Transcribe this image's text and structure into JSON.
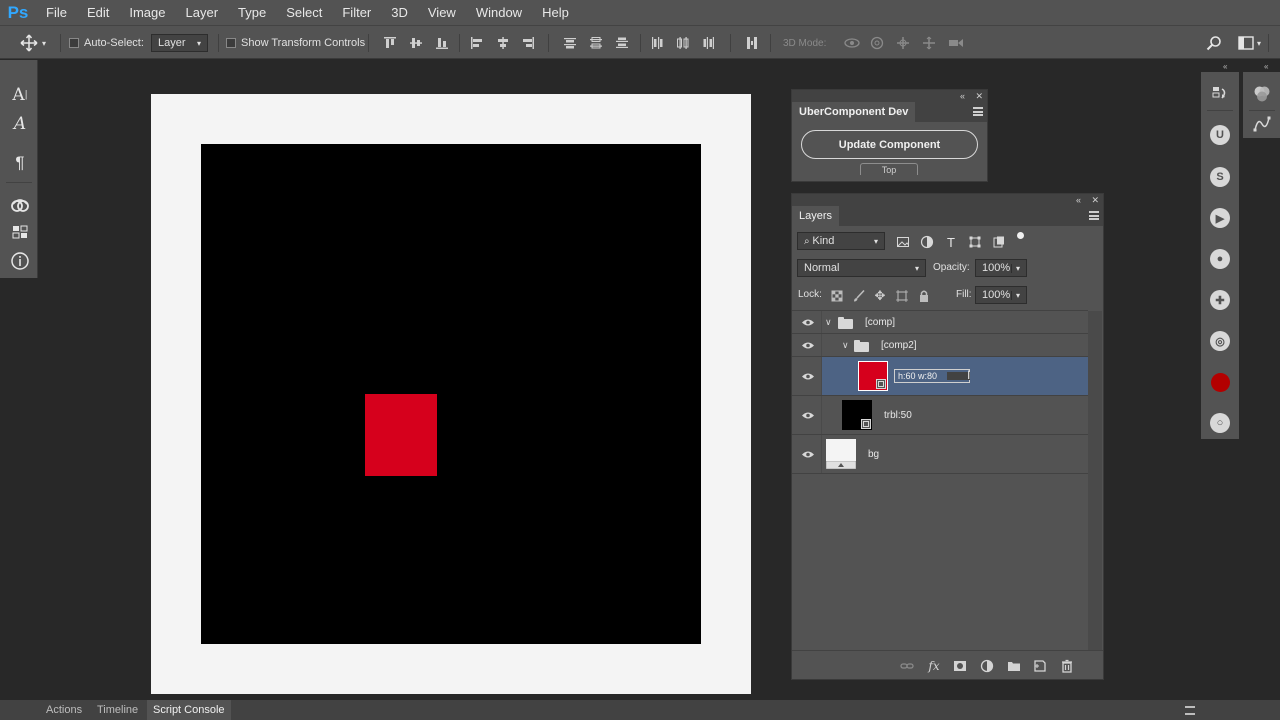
{
  "app": {
    "logo": "Ps"
  },
  "menu": [
    "File",
    "Edit",
    "Image",
    "Layer",
    "Type",
    "Select",
    "Filter",
    "3D",
    "View",
    "Window",
    "Help"
  ],
  "options": {
    "auto_select_label": "Auto-Select:",
    "auto_select_value": "Layer",
    "transform_label": "Show Transform Controls",
    "mode_3d_label": "3D Mode:"
  },
  "uber_panel": {
    "title": "UberComponent Dev",
    "button": "Update Component",
    "small_label": "Top"
  },
  "layers_panel": {
    "title": "Layers",
    "filter_kind": "Kind",
    "blend_mode": "Normal",
    "opacity_label": "Opacity:",
    "opacity_value": "100%",
    "lock_label": "Lock:",
    "fill_label": "Fill:",
    "fill_value": "100%",
    "layers": [
      {
        "name": "[comp]",
        "type": "group",
        "expanded": true
      },
      {
        "name": "[comp2]",
        "type": "group",
        "expanded": true
      },
      {
        "name": "h:60 w:80",
        "type": "shape",
        "selected": true,
        "editing": true
      },
      {
        "name": "trbl:50",
        "type": "shape"
      },
      {
        "name": "bg",
        "type": "fill"
      }
    ]
  },
  "bottom_tabs": [
    "Actions",
    "Timeline",
    "Script Console"
  ],
  "active_bottom_tab": "Script Console",
  "colors": {
    "accent_blue": "#31a8ff",
    "selected_row": "#4d6384",
    "shape_red": "#d6001c"
  }
}
